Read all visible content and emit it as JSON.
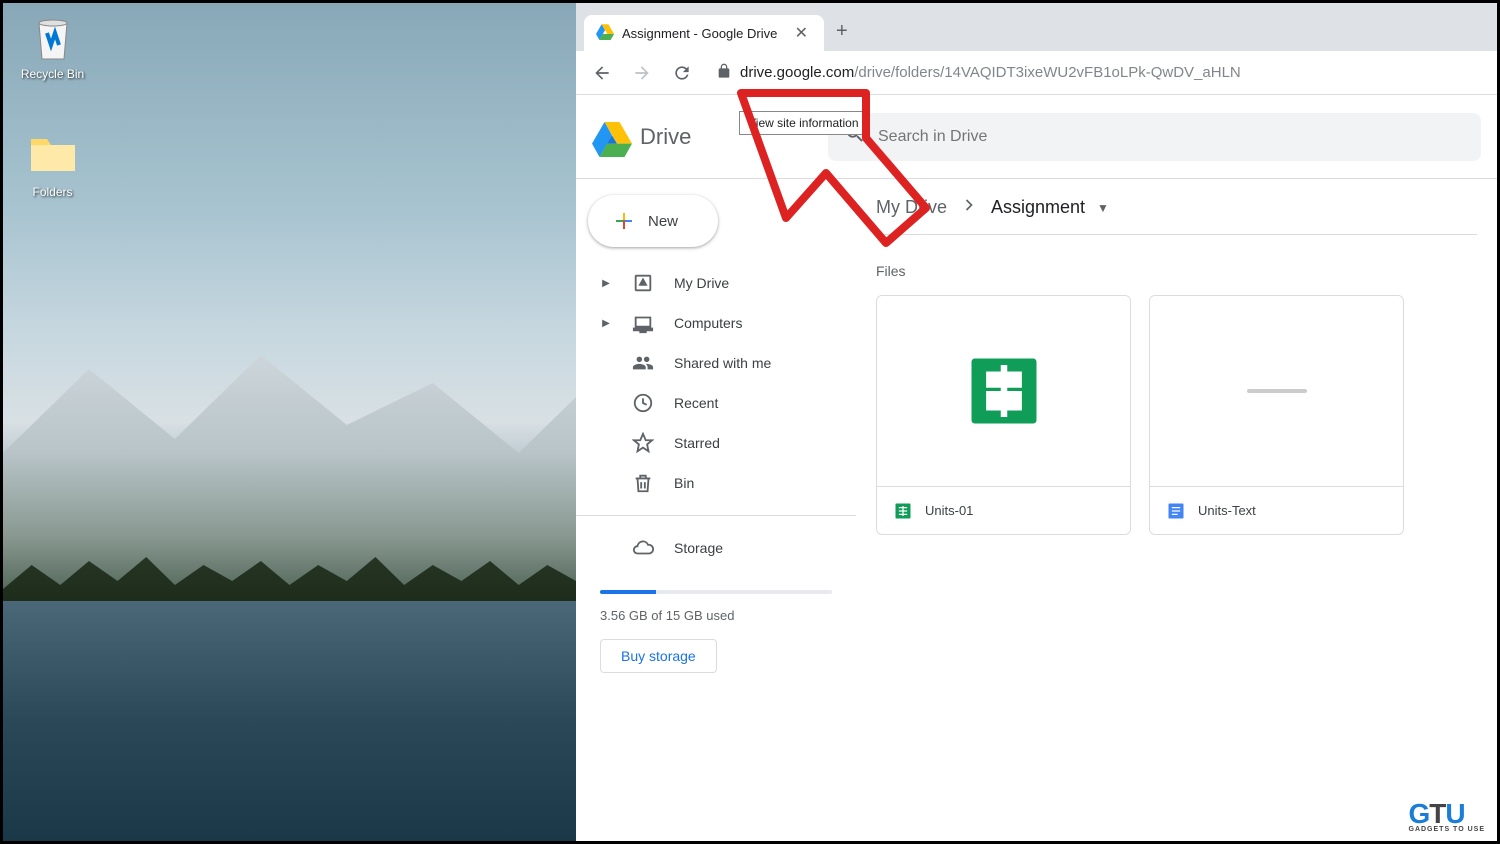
{
  "desktop": {
    "icons": [
      {
        "label": "Recycle Bin",
        "name": "recycle-bin"
      },
      {
        "label": "Folders",
        "name": "folders"
      }
    ]
  },
  "browser": {
    "tab_title": "Assignment - Google Drive",
    "url_host": "drive.google.com",
    "url_path": "/drive/folders/14VAQIDT3ixeWU2vFB1oLPk-QwDV_aHLN",
    "tooltip": "View site information"
  },
  "drive": {
    "logo_text": "Drive",
    "search_placeholder": "Search in Drive",
    "new_button": "New",
    "sidebar": [
      {
        "label": "My Drive",
        "icon": "drive-storage-icon",
        "expandable": true
      },
      {
        "label": "Computers",
        "icon": "computers-icon",
        "expandable": true
      },
      {
        "label": "Shared with me",
        "icon": "shared-icon",
        "expandable": false
      },
      {
        "label": "Recent",
        "icon": "recent-icon",
        "expandable": false
      },
      {
        "label": "Starred",
        "icon": "star-icon",
        "expandable": false
      },
      {
        "label": "Bin",
        "icon": "trash-icon",
        "expandable": false
      }
    ],
    "storage": {
      "label": "Storage",
      "used_text": "3.56 GB of 15 GB used",
      "buy_label": "Buy storage"
    },
    "breadcrumb": {
      "parent": "My Drive",
      "current": "Assignment"
    },
    "files_label": "Files",
    "files": [
      {
        "name": "Units-01",
        "type": "sheets"
      },
      {
        "name": "Units-Text",
        "type": "docs"
      }
    ]
  },
  "watermark": {
    "g": "G",
    "t": "T",
    "u": "U",
    "sub": "GADGETS TO USE"
  }
}
